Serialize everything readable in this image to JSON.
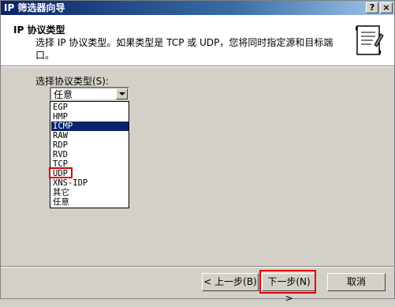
{
  "window": {
    "title": "IP 筛选器向导",
    "help_btn": "?",
    "close_btn": "×"
  },
  "header": {
    "title": "IP 协议类型",
    "description": "选择 IP 协议类型。如果类型是 TCP 或 UDP，您将同时指定源和目标端口。",
    "icon": "wizard-scroll-icon"
  },
  "protocol": {
    "label": "选择协议类型(S):",
    "selected_value": "任意",
    "options": [
      "EGP",
      "HMP",
      "ICMP",
      "RAW",
      "RDP",
      "RVD",
      "TCP",
      "UDP",
      "XNS-IDP",
      "其它",
      "任意"
    ],
    "highlighted_option": "ICMP",
    "annotated_option": "UDP"
  },
  "buttons": {
    "back": "< 上一步(B)",
    "next": "下一步(N) >",
    "cancel": "取消"
  },
  "colors": {
    "selection": "#0a246a",
    "annotation": "#e00000",
    "dialog_bg": "#d4d0c8"
  }
}
